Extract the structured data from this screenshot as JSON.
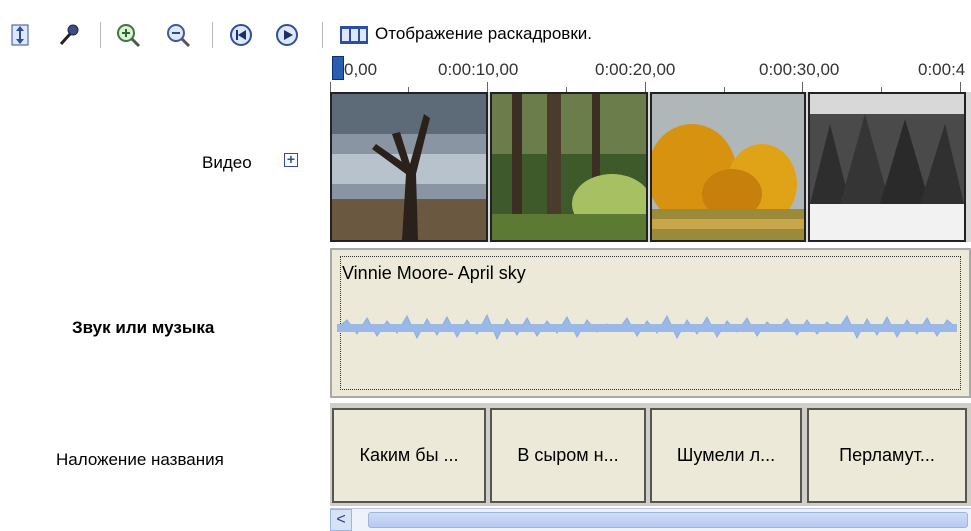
{
  "toolbar": {
    "icons": [
      "set-audio-levels-icon",
      "narrate-microphone-icon",
      "zoom-in-icon",
      "zoom-out-icon",
      "rewind-icon",
      "play-icon",
      "storyboard-view-icon"
    ],
    "storyboard_label": "Отображение раскадровки."
  },
  "ruler": {
    "labels": [
      "0,00",
      "0:00:10,00",
      "0:00:20,00",
      "0:00:30,00",
      "0:00:4"
    ]
  },
  "tracks": {
    "video_label": "Видео",
    "video_expand": "+",
    "audio_label": "Звук или музыка",
    "title_label": "Наложение названия"
  },
  "audio": {
    "clip_title": "Vinnie Moore- April sky"
  },
  "titles": [
    {
      "text": "Каким бы ..."
    },
    {
      "text": "В сыром н..."
    },
    {
      "text": "Шумели л..."
    },
    {
      "text": "Перламут..."
    }
  ],
  "scrollbar": {
    "left_arrow": "<"
  },
  "colors": {
    "wave": "#9ab8e8",
    "accent": "#2b4fa0"
  }
}
